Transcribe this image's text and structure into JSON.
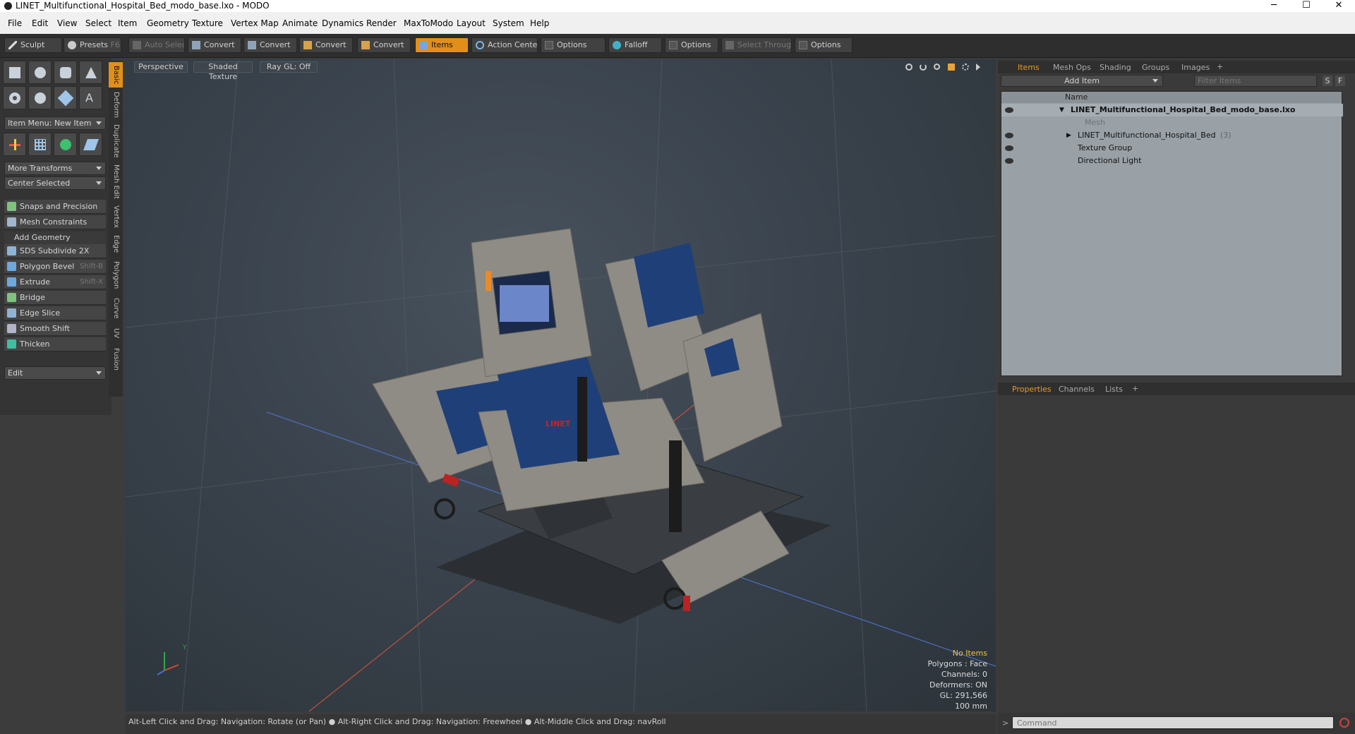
{
  "window": {
    "title": "LINET_Multifunctional_Hospital_Bed_modo_base.lxo - MODO",
    "controls": [
      "─",
      "☐",
      "✕"
    ]
  },
  "menu": [
    "File",
    "Edit",
    "View",
    "Select",
    "Item",
    "Geometry",
    "Texture",
    "Vertex Map",
    "Animate",
    "Dynamics",
    "Render",
    "MaxToModo",
    "Layout",
    "System",
    "Help"
  ],
  "toolbar": {
    "sculpt": "Sculpt",
    "presets": "Presets",
    "presets_shortcut": "F6",
    "auto_select": "Auto Select",
    "convert1": "Convert",
    "convert2": "Convert",
    "convert3": "Convert",
    "convert4": "Convert",
    "items": "Items",
    "action_center": "Action Center",
    "options1": "Options",
    "falloff": "Falloff",
    "options2": "Options",
    "select_through": "Select Through",
    "options3": "Options"
  },
  "left_panel": {
    "item_menu": "Item Menu: New Item",
    "more_transforms": "More Transforms",
    "center_selected": "Center Selected",
    "snaps": "Snaps and Precision",
    "mesh_constraints": "Mesh Constraints",
    "add_geometry": "Add Geometry",
    "tools": [
      {
        "label": "SDS Subdivide 2X",
        "shortcut": ""
      },
      {
        "label": "Polygon Bevel",
        "shortcut": "Shift-B"
      },
      {
        "label": "Extrude",
        "shortcut": "Shift-X"
      },
      {
        "label": "Bridge",
        "shortcut": ""
      },
      {
        "label": "Edge Slice",
        "shortcut": ""
      },
      {
        "label": "Smooth Shift",
        "shortcut": ""
      },
      {
        "label": "Thicken",
        "shortcut": ""
      }
    ],
    "edit": "Edit"
  },
  "side_tabs": [
    "Basic",
    "Deform",
    "Duplicate",
    "Mesh Edit",
    "Vertex",
    "Edge",
    "Polygon",
    "Curve",
    "UV",
    "Fusion"
  ],
  "viewport": {
    "view_mode": "Perspective",
    "shading": "Shaded Texture",
    "raygl": "Ray GL: Off",
    "info": {
      "items": "No Items",
      "polygons": "Polygons : Face",
      "channels": "Channels: 0",
      "deformers": "Deformers: ON",
      "gl": "GL: 291,566",
      "unit": "100 mm"
    },
    "bed_logo": "LINET"
  },
  "right_panel": {
    "tabs": [
      "Items",
      "Mesh Ops",
      "Shading",
      "Groups",
      "Images"
    ],
    "add_item": "Add Item",
    "filter_placeholder": "Filter Items",
    "filter_s": "S",
    "filter_f": "F",
    "column_name": "Name",
    "tree": [
      {
        "label": "LINET_Multifunctional_Hospital_Bed_modo_base.lxo",
        "indent": 0
      },
      {
        "label": "Mesh",
        "indent": 1
      },
      {
        "label": "LINET_Multifunctional_Hospital_Bed",
        "count": "(3)",
        "indent": 1
      },
      {
        "label": "Texture Group",
        "indent": 1
      },
      {
        "label": "Directional Light",
        "indent": 1
      }
    ],
    "bottom_tabs": [
      "Properties",
      "Channels",
      "Lists"
    ]
  },
  "status": {
    "hint1": "Alt-Left Click and Drag: Navigation: Rotate (or Pan)",
    "hint2": "Alt-Right Click and Drag: Navigation: Freewheel",
    "hint3": "Alt-Middle Click and Drag: navRoll"
  },
  "command": {
    "placeholder": "Command"
  },
  "colors": {
    "accent": "#e28f1a",
    "bed_blue": "#1f3f78",
    "frame": "#8f8c85"
  }
}
